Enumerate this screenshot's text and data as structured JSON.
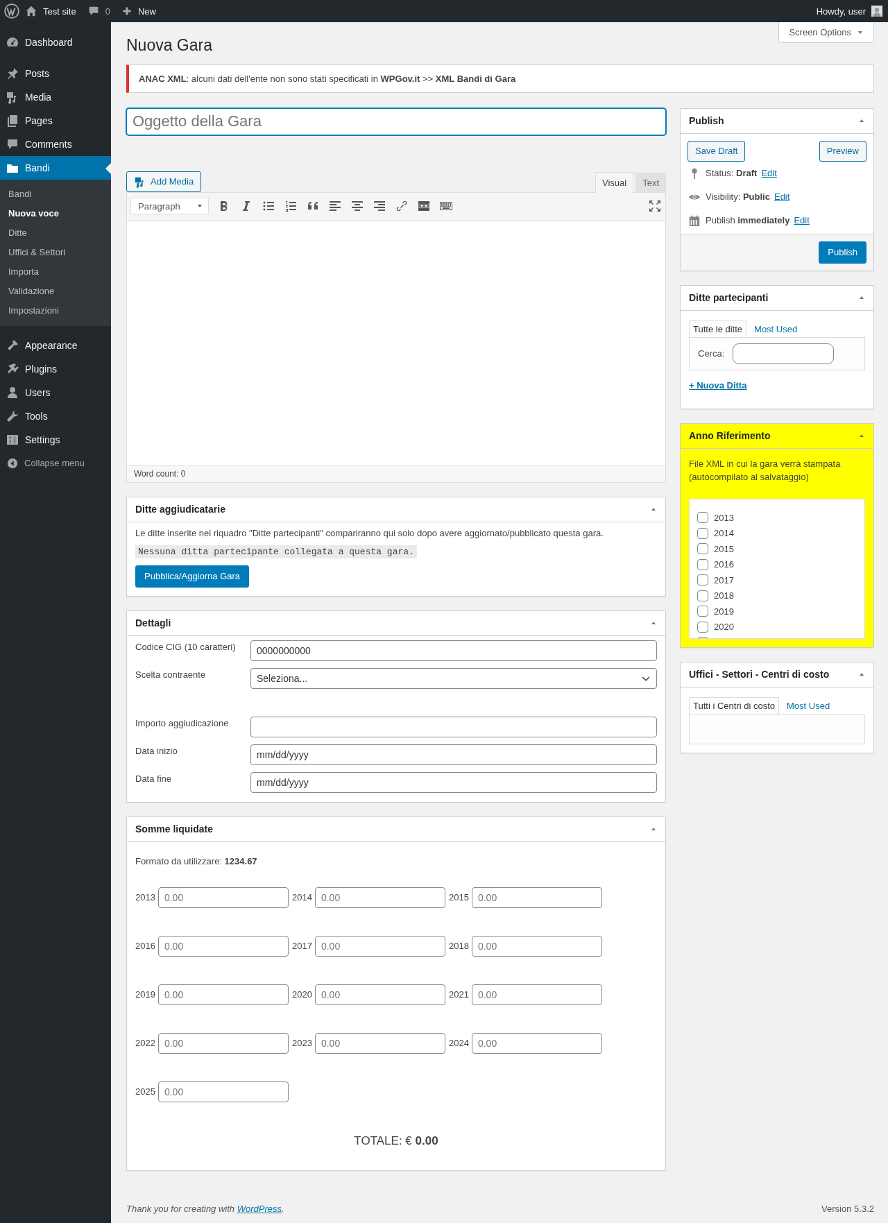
{
  "admin_bar": {
    "site": "Test site",
    "comments": "0",
    "new": "New",
    "greeting": "Howdy, user"
  },
  "menu_groups": [
    [
      {
        "label": "Dashboard",
        "selected": false
      }
    ],
    [
      {
        "label": "Posts",
        "selected": false
      },
      {
        "label": "Media",
        "selected": false
      },
      {
        "label": "Pages",
        "selected": false
      },
      {
        "label": "Comments",
        "selected": false
      },
      {
        "label": "Bandi",
        "selected": true,
        "children": [
          {
            "label": "Bandi",
            "selected": false
          },
          {
            "label": "Nuova voce",
            "selected": true
          },
          {
            "label": "Ditte",
            "selected": false
          },
          {
            "label": "Uffici & Settori",
            "selected": false
          },
          {
            "label": "Importa",
            "selected": false
          },
          {
            "label": "Validazione",
            "selected": false
          },
          {
            "label": "Impostazioni",
            "selected": false
          }
        ]
      }
    ],
    [
      {
        "label": "Appearance",
        "selected": false
      },
      {
        "label": "Plugins",
        "selected": false
      },
      {
        "label": "Users",
        "selected": false
      },
      {
        "label": "Tools",
        "selected": false
      },
      {
        "label": "Settings",
        "selected": false
      }
    ]
  ],
  "collapse": "Collapse menu",
  "screen_options": "Screen Options",
  "page_title": "Nuova Gara",
  "notice": "**ANAC XML**: alcuni dati dell'ente non sono stati specificati in **WPGov.it** >> **XML Bandi di Gara**",
  "title_field": {
    "placeholder": "Oggetto della Gara"
  },
  "editor": {
    "add_media": "Add Media",
    "tabs": [
      {
        "label": "Visual",
        "selected": true
      },
      {
        "label": "Text",
        "selected": false
      }
    ],
    "format": "Paragraph",
    "word_count": "Word count: 0"
  },
  "ditte_aggiudicatarie": {
    "title": "Ditte aggiudicatarie",
    "text": "Le ditte inserite nel riquadro \"Ditte partecipanti\" compariranno qui solo dopo avere aggiornato/pubblicato questa gara.",
    "code": "Nessuna ditta partecipante collegata a questa gara.",
    "button": "Pubblica/Aggiorna Gara"
  },
  "dettagli": {
    "title": "Dettagli",
    "fields": [
      {
        "kind": "text",
        "label": "Codice CIG (10 caratteri)",
        "value": "0000000000"
      },
      {
        "kind": "select",
        "label": "Scelta contraente",
        "value": "Seleziona..."
      },
      {
        "kind": "text",
        "label": "Importo aggiudicazione"
      },
      {
        "kind": "text",
        "label": "Data inizio",
        "value": "mm/dd/yyyy"
      },
      {
        "kind": "text",
        "label": "Data fine",
        "value": "mm/dd/yyyy"
      }
    ]
  },
  "somme": {
    "title": "Somme liquidate",
    "format_note": "Formato da utilizzare: **1234.67**",
    "fields": [
      {
        "year": "2013",
        "placeholder": "0.00"
      },
      {
        "year": "2014",
        "placeholder": "0.00"
      },
      {
        "year": "2015",
        "placeholder": "0.00"
      },
      {
        "year": "2016",
        "placeholder": "0.00"
      },
      {
        "year": "2017",
        "placeholder": "0.00"
      },
      {
        "year": "2018",
        "placeholder": "0.00"
      },
      {
        "year": "2019",
        "placeholder": "0.00"
      },
      {
        "year": "2020",
        "placeholder": "0.00"
      },
      {
        "year": "2021",
        "placeholder": "0.00"
      },
      {
        "year": "2022",
        "placeholder": "0.00"
      },
      {
        "year": "2023",
        "placeholder": "0.00"
      },
      {
        "year": "2024",
        "placeholder": "0.00"
      },
      {
        "year": "2025",
        "placeholder": "0.00"
      }
    ],
    "total": "TOTALE: € **0.00**"
  },
  "publish": {
    "title": "Publish",
    "save_draft": "Save Draft",
    "preview": "Preview",
    "rows": [
      {
        "text": "Status: **Draft**",
        "link": "Edit"
      },
      {
        "text": "Visibility: **Public**",
        "link": "Edit"
      },
      {
        "text": "Publish **immediately**",
        "link": "Edit"
      }
    ],
    "button": "Publish"
  },
  "ditte_partecipanti": {
    "title": "Ditte partecipanti",
    "tabs": [
      {
        "label": "Tutte le ditte",
        "selected": true
      },
      {
        "label": "Most Used",
        "selected": false
      }
    ],
    "search_label": "Cerca:",
    "add_link": "+ Nuova Ditta"
  },
  "anno": {
    "title": "Anno Riferimento",
    "description": "File XML in cui la gara verrà stampata (autocompilato al salvataggio)",
    "years": [
      {
        "label": "2013",
        "checked": false
      },
      {
        "label": "2014",
        "checked": false
      },
      {
        "label": "2015",
        "checked": false
      },
      {
        "label": "2016",
        "checked": false
      },
      {
        "label": "2017",
        "checked": false
      },
      {
        "label": "2018",
        "checked": false
      },
      {
        "label": "2019",
        "checked": false
      },
      {
        "label": "2020",
        "checked": false
      },
      {
        "checked": false
      }
    ]
  },
  "uffici": {
    "title": "Uffici - Settori - Centri di costo",
    "tabs": [
      {
        "label": "Tutti i Centri di costo",
        "selected": true
      },
      {
        "label": "Most Used",
        "selected": false
      }
    ]
  },
  "footer": {
    "text": "Thank you for creating with ",
    "link": "WordPress",
    "after": ".",
    "version": "Version 5.3.2"
  }
}
